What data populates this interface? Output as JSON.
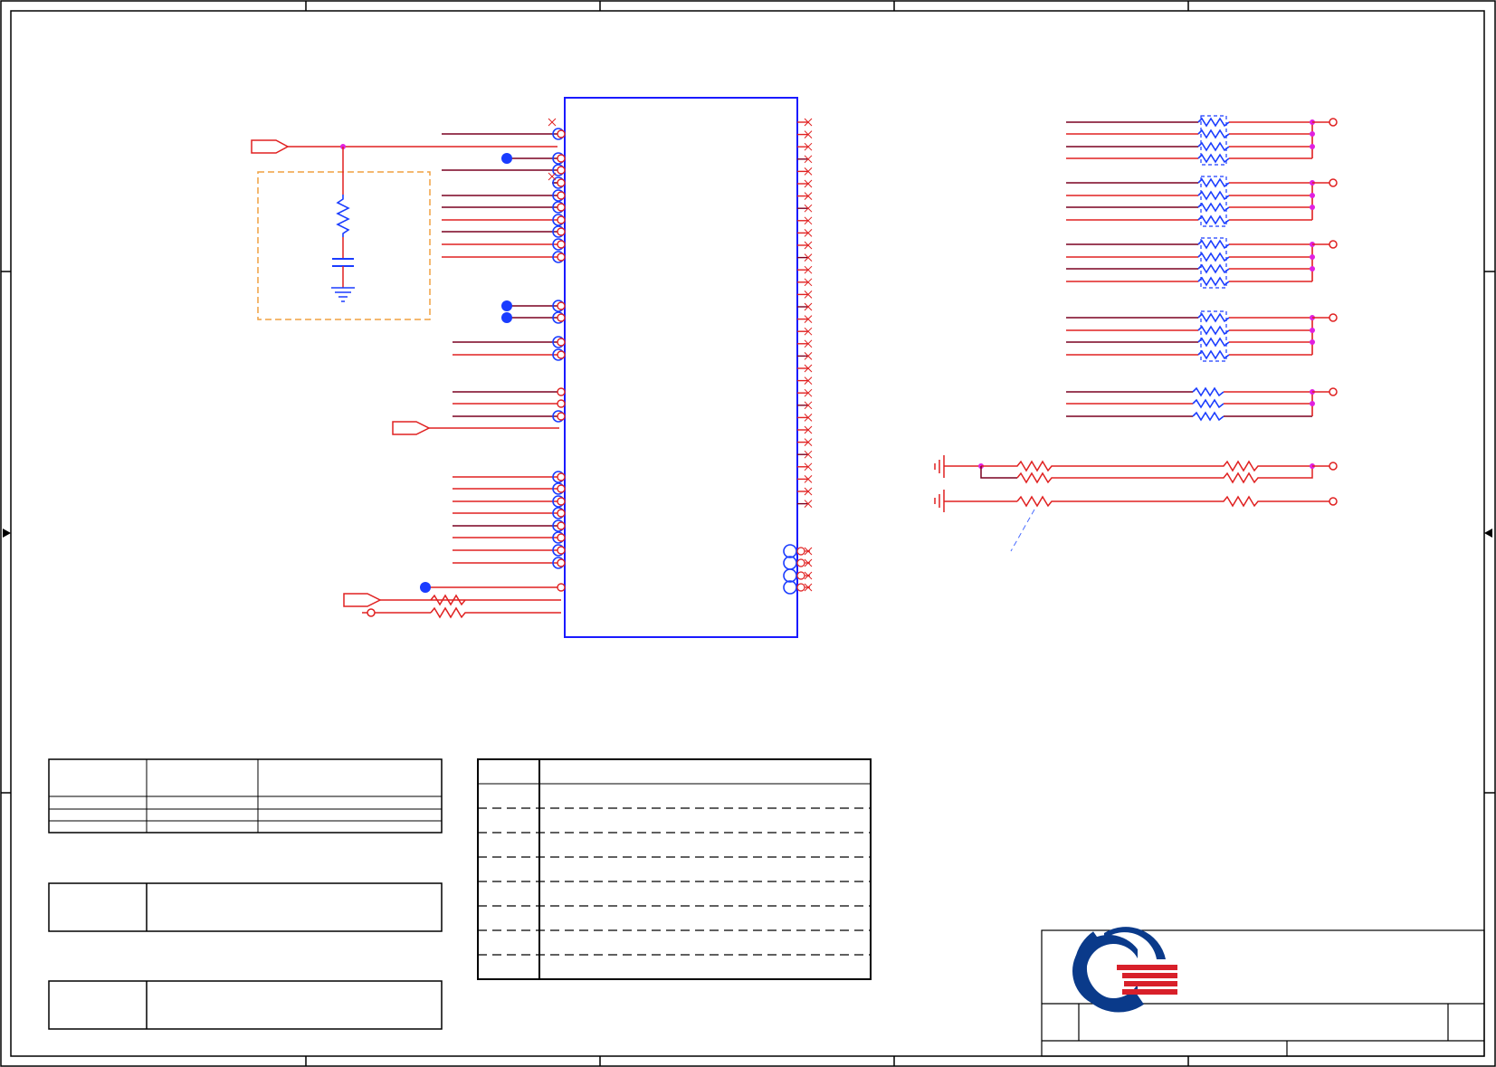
{
  "colors": {
    "background": "#ffffff",
    "frame": "#000000",
    "chip_outline": "#1a1aff",
    "wire_red": "#e02020",
    "wire_dark": "#7a0020",
    "pin_blue": "#1a3cff",
    "junction_magenta": "#e020e0",
    "keepout_orange": "#f0a040",
    "logo_blue": "#0a3a8a",
    "logo_red": "#d8202a"
  },
  "icons": {
    "port": "pentagon-arrow-icon",
    "ground": "ground-symbol-icon",
    "resistor": "zigzag-resistor-icon",
    "capacitor": "capacitor-icon",
    "no_connect": "x-mark-icon",
    "open_terminal": "circle-terminal-icon",
    "logo": "company-logo-icon"
  }
}
